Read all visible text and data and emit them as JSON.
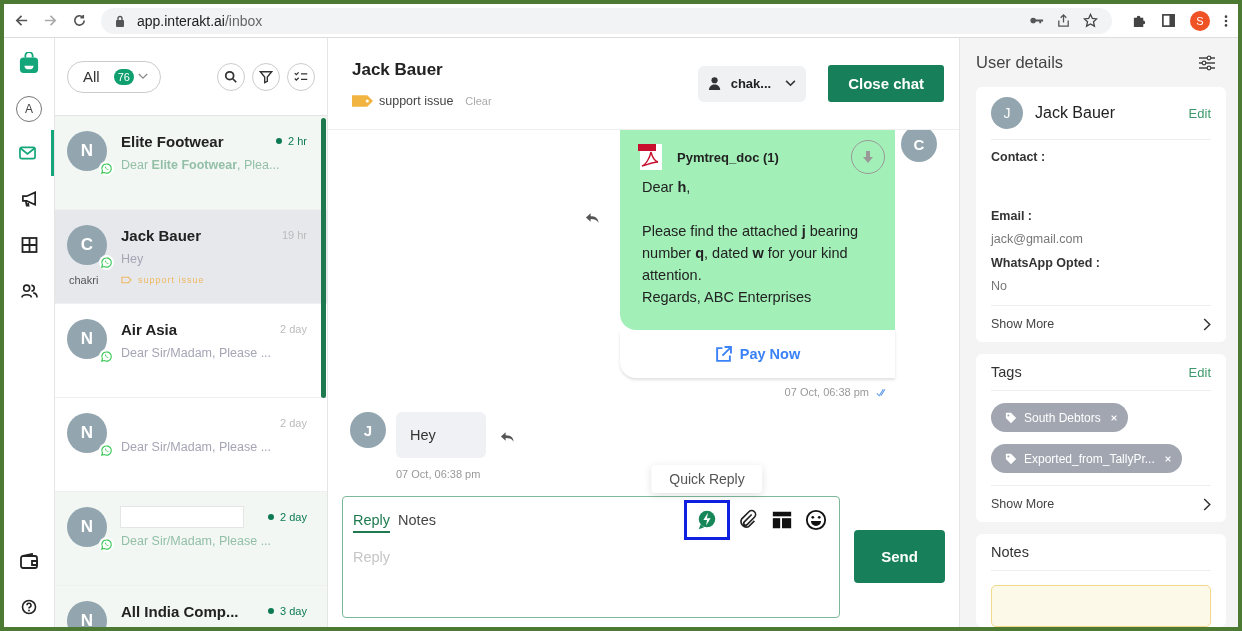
{
  "browser": {
    "url_host": "app.interakt.ai",
    "url_path": "/inbox",
    "profile_initial": "S"
  },
  "nav": {
    "account_initial": "A",
    "items": [
      {
        "kind": "inbox",
        "selected": true
      },
      {
        "kind": "campaigns",
        "selected": false
      },
      {
        "kind": "apps",
        "selected": false
      },
      {
        "kind": "contacts",
        "selected": false
      }
    ]
  },
  "filter": {
    "label": "All",
    "count": "76"
  },
  "conversations": [
    {
      "initial": "N",
      "name": "Elite Footwear",
      "time": "2 hr",
      "preview": "Dear **Elite Footwear**, Plea...",
      "unread": true,
      "selected": false
    },
    {
      "initial": "C",
      "name": "Jack Bauer",
      "time": "19 hr",
      "preview": "Hey",
      "agent": "chakri",
      "tag": "support issue",
      "unread": false,
      "selected": true
    },
    {
      "initial": "N",
      "name": "Air Asia",
      "time": "2 day",
      "preview": "Dear Sir/Madam, Please ...",
      "unread": false,
      "selected": false
    },
    {
      "initial": "N",
      "time": "2 day",
      "preview": "Dear Sir/Madam, Please ...",
      "unread": false,
      "selected": false,
      "redacted": false
    },
    {
      "initial": "N",
      "time": "2 day",
      "preview": "Dear Sir/Madam, Please ...",
      "unread": true,
      "selected": false,
      "redacted": true
    },
    {
      "initial": "N",
      "name": "All India Comp...",
      "time": "3 day",
      "unread": true,
      "selected": false
    }
  ],
  "chat": {
    "contact_name": "Jack Bauer",
    "tag": "support issue",
    "clear_label": "Clear",
    "assignee": "chak...",
    "close_label": "Close chat"
  },
  "messages": [
    {
      "kind": "document",
      "avatar": "C",
      "file_name": "Pymtreq_doc (1)",
      "body": "Dear **h**,\n\nPlease find the attached **j** bearing number **q**, dated **w** for your kind attention.\nRegards, ABC Enterprises",
      "button": "Pay Now",
      "time": "07 Oct, 06:38 pm",
      "read": true
    },
    {
      "kind": "text",
      "avatar": "J",
      "text": "Hey",
      "time": "07 Oct, 06:38 pm"
    }
  ],
  "composer": {
    "tabs": [
      {
        "label": "Reply",
        "selected": true
      },
      {
        "label": "Notes",
        "selected": false
      }
    ],
    "placeholder": "Reply",
    "tooltip": "Quick Reply",
    "send_label": "Send",
    "tools": [
      {
        "kind": "quick_reply",
        "highlighted": true
      },
      {
        "kind": "attach",
        "highlighted": false
      },
      {
        "kind": "template",
        "highlighted": false
      },
      {
        "kind": "emoji",
        "highlighted": false
      }
    ]
  },
  "details": {
    "title": "User details",
    "contact": {
      "initial": "J",
      "name": "Jack Bauer",
      "edit_label": "Edit",
      "show_more": "Show More",
      "fields": [
        {
          "label": "Contact :"
        },
        {
          "label": "Email :",
          "value": "jack@gmail.com"
        },
        {
          "label": "WhatsApp Opted :",
          "value": "No"
        }
      ]
    },
    "tags": {
      "title": "Tags",
      "edit_label": "Edit",
      "show_more": "Show More",
      "items": [
        "South Debtors",
        "Exported_from_TallyPr..."
      ]
    },
    "notes": {
      "title": "Notes"
    }
  }
}
